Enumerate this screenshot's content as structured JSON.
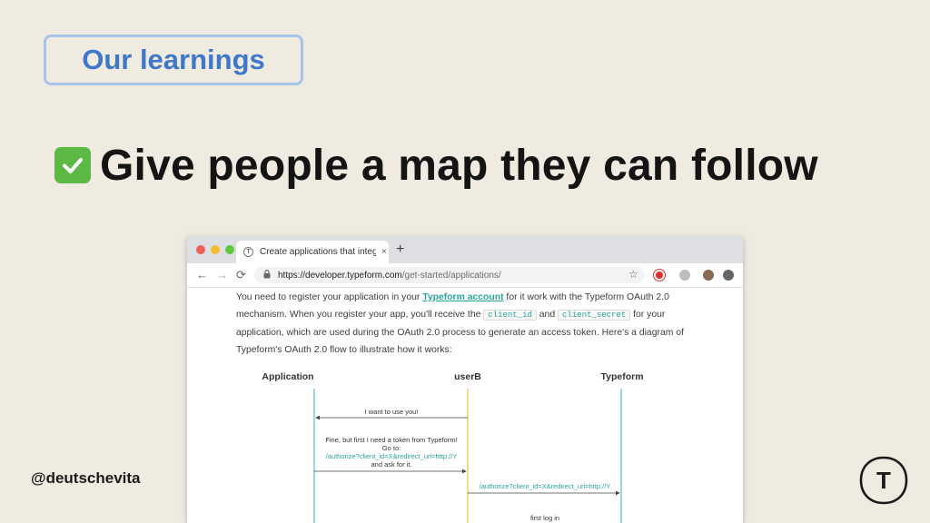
{
  "slide": {
    "section_label": "Our learnings",
    "headline": "Give people a map they can follow",
    "handle": "@deutschevita",
    "logo_letter": "T",
    "colors": {
      "background": "#efebe1",
      "pill_border": "#a9c4ea",
      "pill_text": "#3f78c9",
      "check_green": "#5bb944"
    }
  },
  "browser": {
    "tab": {
      "favicon_letter": "T",
      "title": "Create applications that integr",
      "close": "×"
    },
    "new_tab": "+",
    "nav": {
      "back": "←",
      "forward": "→",
      "reload": "⟳"
    },
    "url": {
      "host": "https://developer.typeform.com",
      "path": "/get-started/applications/"
    },
    "content": {
      "l1_pre": "You need to register your application in your ",
      "l1_link": "Typeform account",
      "l1_post": " for it work with the Typeform OAuth 2.0",
      "l2_pre": "mechanism. When you register your app, you'll receive the ",
      "code1": "client_id",
      "l2_mid": " and ",
      "code2": "client_secret",
      "l2_post": " for your",
      "l3": "application, which are used during the OAuth 2.0 process to generate an access token. Here's a diagram of",
      "l4": "Typeform's OAuth 2.0 flow to illustrate how it works:"
    },
    "diagram": {
      "actors": [
        "Application",
        "userB",
        "Typeform"
      ],
      "msg1": "I want to use you!",
      "msg2_line1": "Fine, but first I need a token from Typeform!",
      "msg2_line2": "Go to:",
      "msg2_line3": "/authorize?client_id=X&redirect_uri=http://Y",
      "msg2_line4": "and ask for it.",
      "msg3": "/authorize?client_id=X&redirect_uri=http://Y",
      "msg4": "first log in"
    }
  }
}
